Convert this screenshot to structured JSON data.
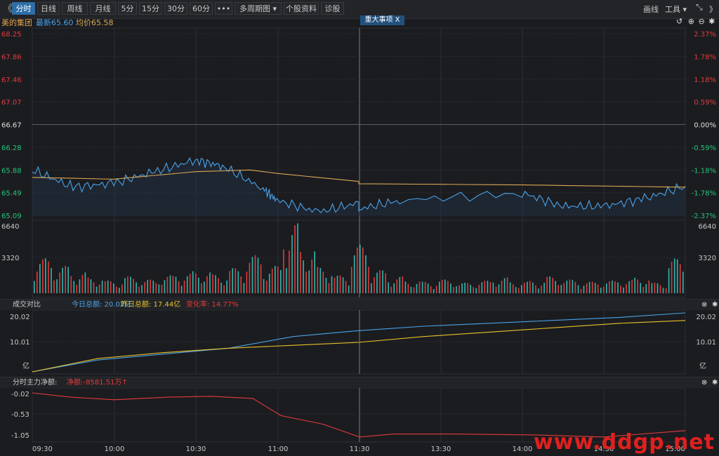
{
  "toolbar": {
    "back_icon": "《",
    "tabs": [
      "分时",
      "日线",
      "周线",
      "月线",
      "5分",
      "15分",
      "30分",
      "60分",
      "•••",
      "多周期图 ▾",
      "个股资料",
      "诊股"
    ],
    "active_tab": "分时",
    "right_draw": "画线",
    "right_tools": "工具 ▾",
    "right_expand_icon": "expand-icon",
    "right_more_icon": "》"
  },
  "info": {
    "stock_name": "美的集团",
    "latest": "最新65.60",
    "avg": "均价65.58",
    "event_tag": "重大事项  X"
  },
  "price_axis": {
    "left": [
      "68.25",
      "67.86",
      "67.46",
      "67.07",
      "66.67",
      "66.28",
      "65.88",
      "65.49",
      "65.09"
    ],
    "right": [
      "2.37%",
      "1.78%",
      "1.18%",
      "0.59%",
      "0.00%",
      "-0.59%",
      "-1.18%",
      "-1.78%",
      "-2.37%"
    ]
  },
  "volume_axis": {
    "left": [
      "6640",
      "3320"
    ],
    "right": [
      "6640",
      "3320"
    ]
  },
  "turnover_panel": {
    "title": "成交对比",
    "today": "今日总额: 20.02亿",
    "yesterday": "昨日总额: 17.44亿",
    "change": "变化率: 14.77%",
    "axis": [
      "20.02",
      "10.01",
      "亿"
    ]
  },
  "flow_panel": {
    "title": "分时主力净额:",
    "net": "净额:-8581.51万↑",
    "axis": [
      "-0.02",
      "-0.53",
      "-1.05"
    ]
  },
  "time_axis": [
    "09:30",
    "10:00",
    "10:30",
    "11:00",
    "11:30",
    "13:30",
    "14:00",
    "14:30",
    "15:00"
  ],
  "watermark": "www.ddgp.net",
  "colors": {
    "up": "#e23b3b",
    "down": "#22c57a",
    "price": "#4aa3e8",
    "avg": "#d9a855",
    "yesterday": "#e8c22a"
  },
  "chart_data": [
    {
      "type": "line",
      "title": "美的集团",
      "ylim": [
        65.09,
        68.25
      ],
      "prev_close": 66.67,
      "series": [
        {
          "name": "最新",
          "x": [
            "09:30",
            "09:45",
            "10:00",
            "10:15",
            "10:30",
            "10:40",
            "10:55",
            "11:00",
            "11:15",
            "11:30",
            "13:30",
            "13:45",
            "14:00",
            "14:15",
            "14:30",
            "14:45",
            "15:00"
          ],
          "values": [
            65.88,
            65.58,
            65.65,
            65.85,
            66.05,
            65.95,
            65.55,
            65.35,
            65.15,
            65.3,
            65.2,
            65.35,
            65.48,
            65.25,
            65.25,
            65.38,
            65.6
          ]
        },
        {
          "name": "均价",
          "x": [
            "09:30",
            "10:00",
            "10:30",
            "10:50",
            "11:00",
            "11:30",
            "13:30",
            "14:00",
            "14:30",
            "15:00"
          ],
          "values": [
            65.75,
            65.72,
            65.85,
            65.88,
            65.82,
            65.68,
            65.64,
            65.62,
            65.6,
            65.58
          ]
        }
      ]
    },
    {
      "type": "bar",
      "title": "volume",
      "ylim": [
        0,
        6640
      ],
      "values": [
        3320,
        2600,
        2000,
        1500,
        1200,
        1600,
        1300,
        1700,
        1900,
        2100,
        1800,
        2400,
        3600,
        2600,
        6640,
        4300,
        2500,
        1700,
        4600,
        2200,
        1600,
        1200,
        1100,
        1300,
        1000,
        1200,
        1500,
        1100,
        1200,
        1600,
        1300,
        1100,
        1200,
        1300,
        1500,
        1000,
        3300
      ]
    },
    {
      "type": "line",
      "title": "成交对比",
      "ylim": [
        0,
        20.02
      ],
      "series": [
        {
          "name": "今日总额",
          "values": [
            0,
            4,
            6,
            8,
            12,
            14,
            15.5,
            16.5,
            17.5,
            18.5,
            20.02
          ]
        },
        {
          "name": "昨日总额",
          "values": [
            0,
            4.5,
            6.5,
            8,
            9,
            10,
            12,
            13.5,
            15,
            16.5,
            17.44
          ]
        }
      ]
    },
    {
      "type": "line",
      "title": "分时主力净额",
      "ylim": [
        -1.1,
        -0.02
      ],
      "series": [
        {
          "name": "净额",
          "values": [
            -0.02,
            -0.12,
            -0.18,
            -0.12,
            -0.1,
            -0.15,
            -0.55,
            -0.75,
            -1.05,
            -0.98,
            -0.98,
            -1.0,
            -1.05,
            -0.9
          ]
        }
      ]
    }
  ]
}
